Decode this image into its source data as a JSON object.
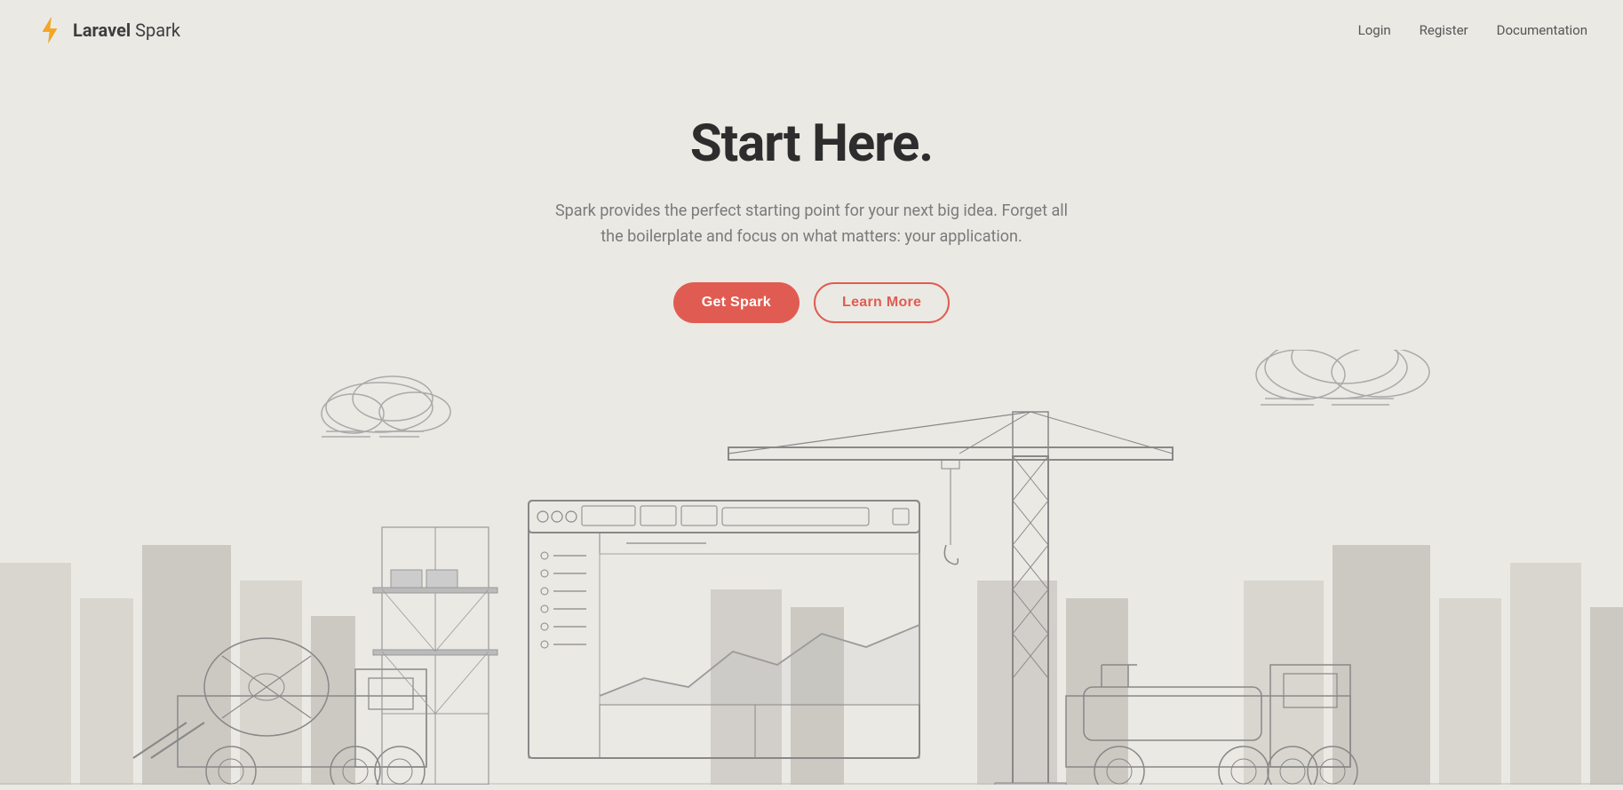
{
  "brand": {
    "name_bold": "Laravel",
    "name_light": " Spark"
  },
  "nav": {
    "links": [
      {
        "label": "Login",
        "href": "#"
      },
      {
        "label": "Register",
        "href": "#"
      },
      {
        "label": "Documentation",
        "href": "#"
      }
    ]
  },
  "hero": {
    "heading": "Start Here.",
    "description": "Spark provides the perfect starting point for your next big idea. Forget all the boilerplate and focus on what matters: your application.",
    "btn_primary": "Get Spark",
    "btn_secondary": "Learn More"
  },
  "colors": {
    "accent": "#e05c52",
    "bg": "#ebe9e4",
    "text_dark": "#2d2d2d",
    "text_muted": "#7a7a7a",
    "line": "#aaa"
  }
}
